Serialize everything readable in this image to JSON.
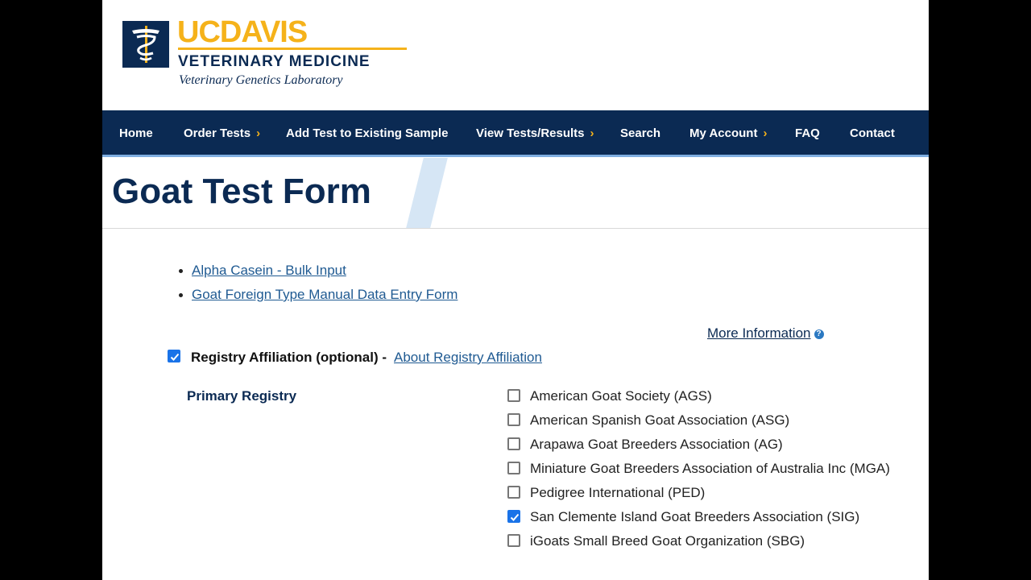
{
  "brand": {
    "uc": "UC",
    "davis": "DAVIS",
    "school": "VETERINARY MEDICINE",
    "lab": "Veterinary Genetics Laboratory",
    "colors": {
      "navy": "#0b2a53",
      "gold": "#f5b21a"
    }
  },
  "nav": {
    "items": [
      {
        "label": "Home",
        "has_chevron": false
      },
      {
        "label": "Order Tests",
        "has_chevron": true
      },
      {
        "label": "Add Test to Existing Sample",
        "has_chevron": false
      },
      {
        "label": "View Tests/Results",
        "has_chevron": true
      },
      {
        "label": "Search",
        "has_chevron": false
      },
      {
        "label": "My Account",
        "has_chevron": true
      },
      {
        "label": "FAQ",
        "has_chevron": false
      },
      {
        "label": "Contact",
        "has_chevron": false
      }
    ],
    "chevron": "›"
  },
  "page": {
    "title": "Goat Test Form"
  },
  "links": [
    {
      "label": "Alpha Casein - Bulk Input"
    },
    {
      "label": "Goat Foreign Type Manual Data Entry Form"
    }
  ],
  "more_info": {
    "label": "More Information",
    "icon": "question-circle-icon"
  },
  "affiliation": {
    "checked": true,
    "label": "Registry Affiliation (optional)",
    "separator": "-",
    "link": "About Registry Affiliation"
  },
  "primary_registry": {
    "label": "Primary Registry",
    "options": [
      {
        "label": "American Goat Society (AGS)",
        "checked": false
      },
      {
        "label": "American Spanish Goat Association (ASG)",
        "checked": false
      },
      {
        "label": "Arapawa Goat Breeders Association (AG)",
        "checked": false
      },
      {
        "label": "Miniature Goat Breeders Association of Australia Inc (MGA)",
        "checked": false
      },
      {
        "label": "Pedigree International (PED)",
        "checked": false
      },
      {
        "label": "San Clemente Island Goat Breeders Association (SIG)",
        "checked": true
      },
      {
        "label": "iGoats Small Breed Goat Organization (SBG)",
        "checked": false
      }
    ]
  }
}
